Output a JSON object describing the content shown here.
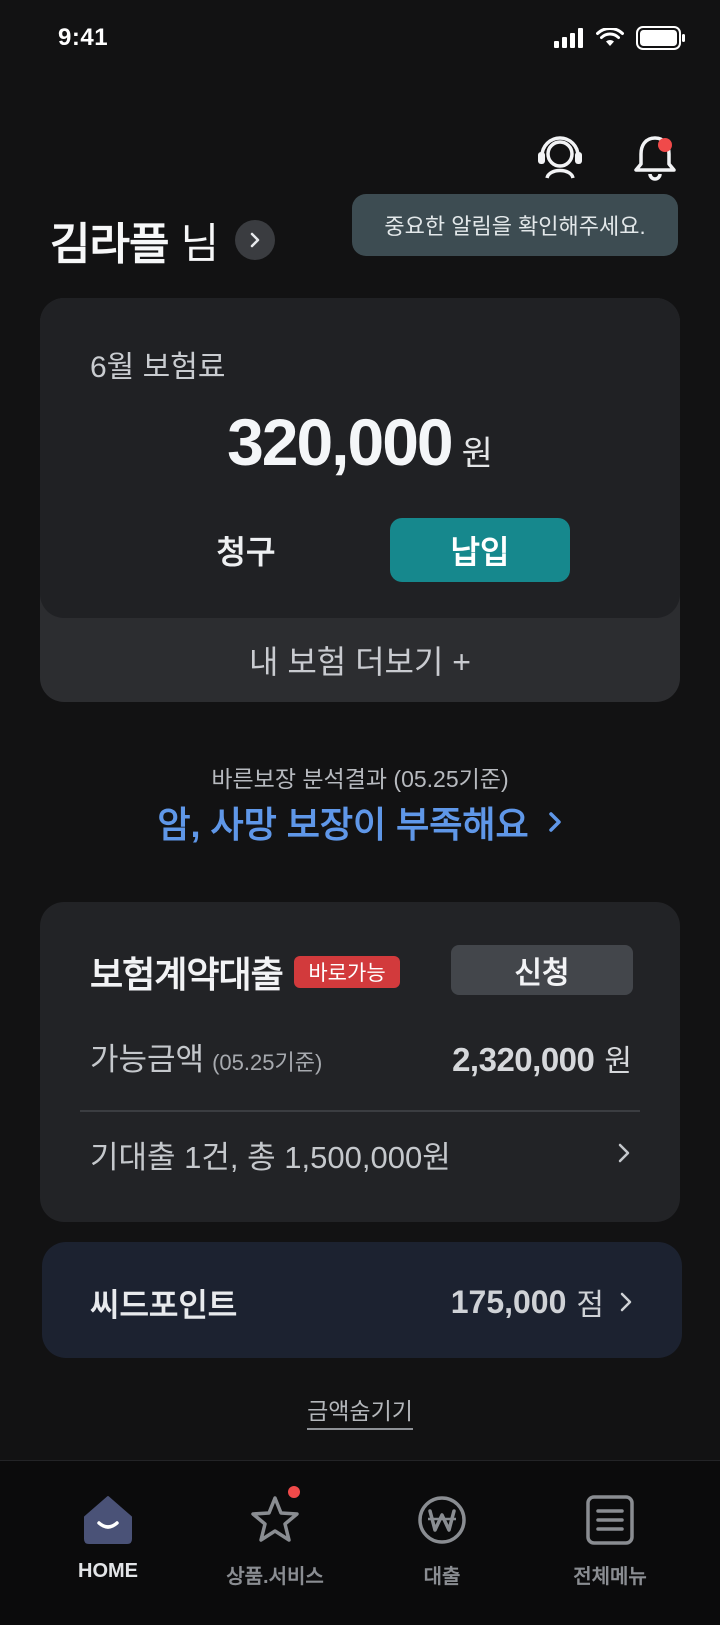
{
  "status_bar": {
    "time": "9:41"
  },
  "header": {
    "greeting_name": "김라플",
    "greeting_suffix": "님",
    "tooltip": "중요한 알림을 확인해주세요."
  },
  "premium": {
    "label": "6월 보험료",
    "amount": "320,000",
    "unit": "원",
    "claim_label": "청구",
    "pay_label": "납입",
    "more_label": "내 보험 더보기 +"
  },
  "analysis": {
    "caption": "바른보장 분석결과 (05.25기준)",
    "headline": "암, 사망 보장이 부족해요"
  },
  "loan": {
    "title": "보험계약대출",
    "badge": "바로가능",
    "apply_label": "신청",
    "available_label": "가능금액",
    "available_date": "(05.25기준)",
    "available_amount": "2,320,000",
    "available_unit": "원",
    "existing": "기대출 1건, 총 1,500,000원"
  },
  "seed_point": {
    "label": "씨드포인트",
    "value": "175,000",
    "unit": "점"
  },
  "hide_amount_label": "금액숨기기",
  "tabs": [
    {
      "label": "HOME",
      "icon": "home-icon",
      "active": true
    },
    {
      "label": "상품.서비스",
      "icon": "star-icon",
      "active": false,
      "notification": true
    },
    {
      "label": "대출",
      "icon": "won-icon",
      "active": false
    },
    {
      "label": "전체메뉴",
      "icon": "menu-icon",
      "active": false
    }
  ],
  "colors": {
    "background": "#121213",
    "accent_teal": "#16888d",
    "link_blue": "#5f97e8",
    "badge_red": "#d23a3c",
    "notification_red": "#f04a4a"
  }
}
